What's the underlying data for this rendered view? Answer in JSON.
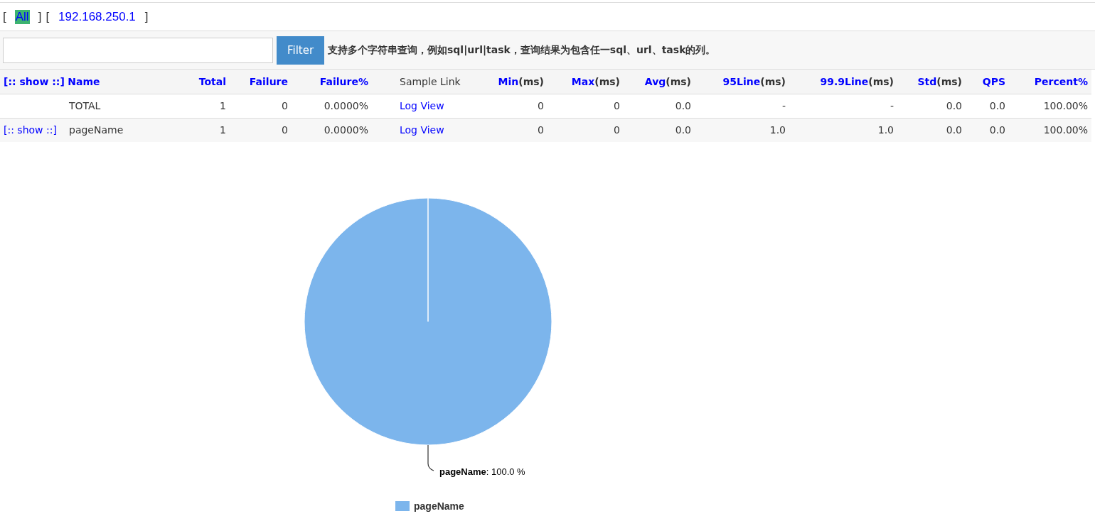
{
  "nav": {
    "items": [
      {
        "open": "[",
        "label": "All",
        "close": "]",
        "selected": true
      },
      {
        "open": "[",
        "label": "192.168.250.1",
        "close": "]",
        "selected": false
      }
    ]
  },
  "filter": {
    "button": "Filter",
    "hint": "支持多个字符串查询，例如sql|url|task，查询结果为包含任一sql、url、task的列。"
  },
  "table": {
    "show_all": "[:: show ::]",
    "columns": [
      {
        "label": "Name",
        "link": true,
        "kind": "text"
      },
      {
        "label": "Total",
        "link": true,
        "kind": "text"
      },
      {
        "label": "Failure",
        "link": true,
        "kind": "text"
      },
      {
        "label": "Failure%",
        "link": true,
        "kind": "text"
      },
      {
        "label": "Sample Link",
        "link": false,
        "kind": "link"
      },
      {
        "label": "Min",
        "unit": "(ms)",
        "link": true,
        "kind": "text"
      },
      {
        "label": "Max",
        "unit": "(ms)",
        "link": true,
        "kind": "text"
      },
      {
        "label": "Avg",
        "unit": "(ms)",
        "link": true,
        "kind": "text"
      },
      {
        "label": "95Line",
        "unit": "(ms)",
        "link": true,
        "kind": "text"
      },
      {
        "label": "99.9Line",
        "unit": "(ms)",
        "link": true,
        "kind": "text"
      },
      {
        "label": "Std",
        "unit": "(ms)",
        "link": true,
        "kind": "text"
      },
      {
        "label": "QPS",
        "link": true,
        "kind": "text"
      },
      {
        "label": "Percent%",
        "link": true,
        "kind": "text"
      }
    ],
    "rows": [
      {
        "cells": [
          "TOTAL",
          "1",
          "0",
          "0.0000%",
          "Log View",
          "0",
          "0",
          "0.0",
          "-",
          "-",
          "0.0",
          "0.0",
          "100.00%"
        ]
      },
      {
        "show": "[:: show ::]",
        "cells": [
          "pageName",
          "1",
          "0",
          "0.0000%",
          "Log View",
          "0",
          "0",
          "0.0",
          "1.0",
          "1.0",
          "0.0",
          "0.0",
          "100.00%"
        ]
      }
    ]
  },
  "chart_data": {
    "type": "pie",
    "categories": [
      "pageName"
    ],
    "series": [
      {
        "name": "pageName",
        "color": "#7cb5ec",
        "values": [
          100
        ]
      }
    ],
    "value_labels": [
      ": 100.0 %"
    ]
  }
}
